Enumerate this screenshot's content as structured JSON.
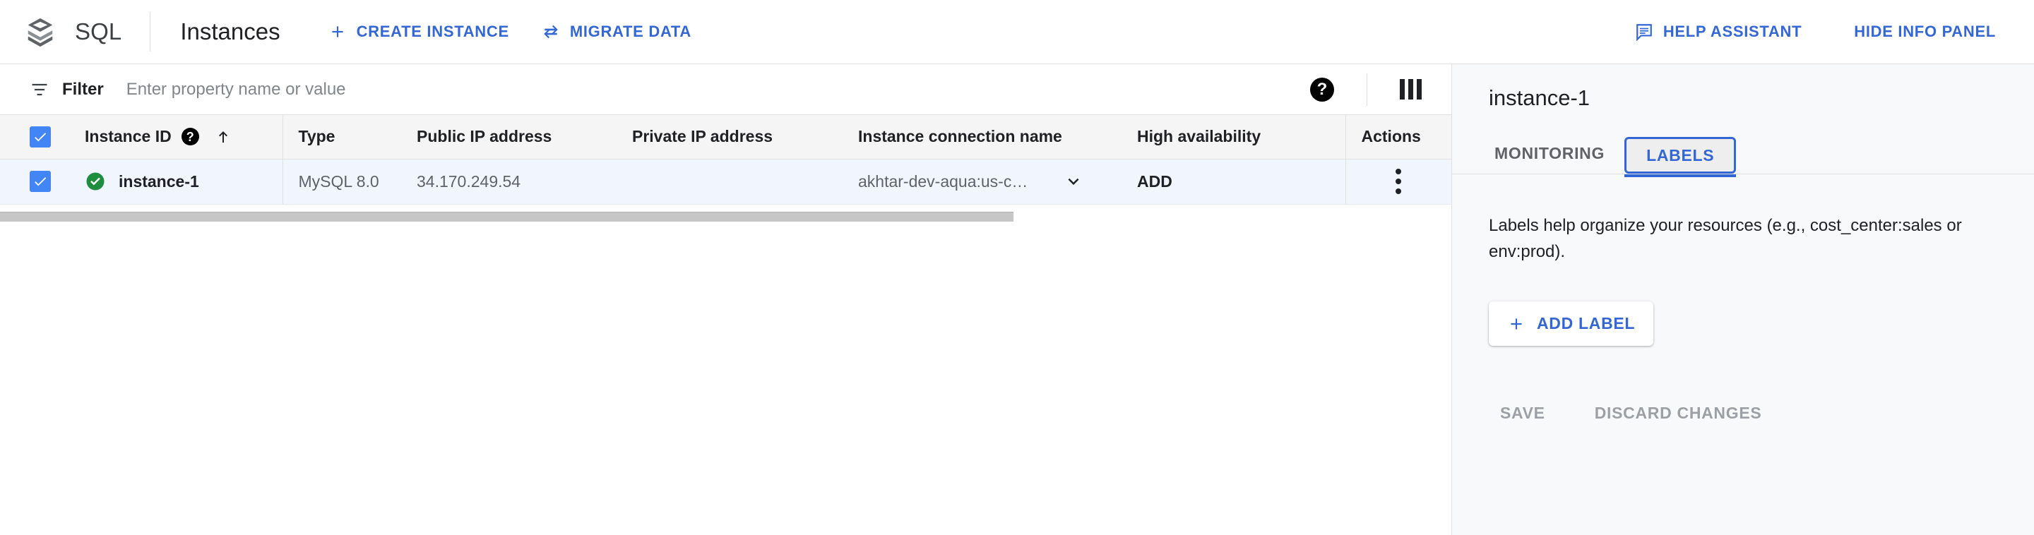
{
  "header": {
    "brand_name": "SQL",
    "brand_logo_icon": "cloud-sql-stack-logo",
    "page_title": "Instances",
    "actions": [
      {
        "label": "CREATE INSTANCE",
        "icon": "plus-icon"
      },
      {
        "label": "MIGRATE DATA",
        "icon": "swap-arrows-icon"
      }
    ],
    "right_actions": [
      {
        "label": "HELP ASSISTANT",
        "icon": "chat-help-icon"
      },
      {
        "label": "HIDE INFO PANEL",
        "icon": "none"
      }
    ]
  },
  "filterbar": {
    "icon": "filter-icon",
    "label": "Filter",
    "placeholder": "Enter property name or value",
    "value": "",
    "help_icon": "help-icon",
    "help_glyph": "?",
    "columns_icon": "column-display-options-icon"
  },
  "table": {
    "columns": [
      "Instance ID",
      "Type",
      "Public IP address",
      "Private IP address",
      "Instance connection name",
      "High availability",
      "Actions"
    ],
    "sort_icon": "arrow-up-icon",
    "header_help_glyph": "?",
    "select_all_checked": true,
    "rows": [
      {
        "checked": true,
        "status_icon": "green-check-circle-icon",
        "instance_id": "instance-1",
        "type": "MySQL 8.0",
        "public_ip": "34.170.249.54",
        "private_ip": "",
        "connection_name": "akhtar-dev-aqua:us-c…",
        "connection_chevron": "chevron-down-icon",
        "high_availability": "ADD",
        "actions_icon": "more-vert-icon"
      }
    ]
  },
  "info_panel": {
    "title": "instance-1",
    "tabs": [
      {
        "label": "MONITORING",
        "active": false
      },
      {
        "label": "LABELS",
        "active": true
      }
    ],
    "description": "Labels help organize your resources (e.g., cost_center:sales or env:prod).",
    "add_label_button": "ADD LABEL",
    "add_label_icon": "plus-icon",
    "save_button": "SAVE",
    "discard_button": "DISCARD CHANGES"
  },
  "colors": {
    "accent_blue": "#3367d6",
    "checkbox_blue": "#4285f4",
    "status_green": "#34a853",
    "selected_row": "#f1f5fd",
    "panel_bg": "#f8f9fa"
  }
}
